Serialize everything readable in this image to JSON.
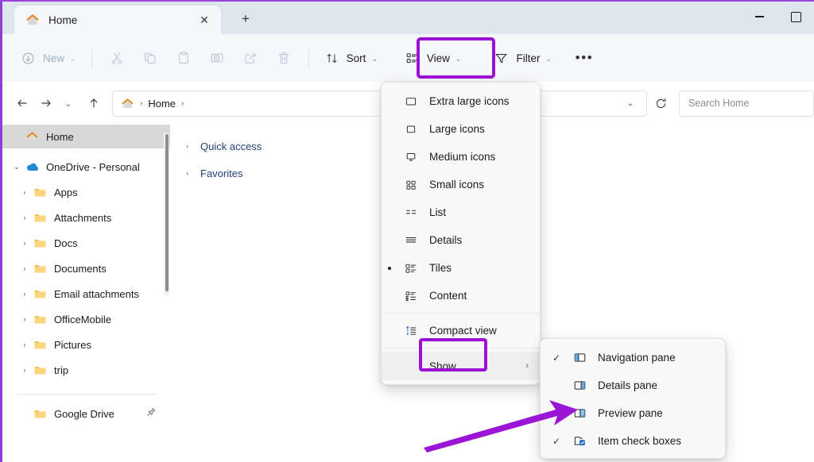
{
  "window": {
    "tab_title": "Home",
    "tab_icon": "home-icon",
    "close_label": "✕",
    "new_tab_label": "+",
    "minimize_label": "minimize-icon",
    "maximize_label": "maximize-icon"
  },
  "toolbar": {
    "new_label": "New",
    "new_chevron": "⌄",
    "cut_label": "cut-icon",
    "copy_label": "copy-icon",
    "paste_label": "paste-icon",
    "rename_label": "rename-icon",
    "share_label": "share-icon",
    "delete_label": "delete-icon",
    "sort_label": "Sort",
    "sort_chevron": "⌄",
    "view_label": "View",
    "view_chevron": "⌄",
    "filter_label": "Filter",
    "filter_chevron": "⌄",
    "overflow_label": "•••"
  },
  "navbar": {
    "back": "←",
    "forward": "→",
    "recent_chevron": "⌄",
    "up": "↑",
    "breadcrumb": {
      "home_icon": "home-icon",
      "sep1": "›",
      "home_text": "Home",
      "sep2": "›"
    },
    "address_chevron": "⌄",
    "refresh": "refresh-icon",
    "search_placeholder": "Search Home"
  },
  "sidebar": {
    "items": [
      {
        "label": "Home",
        "icon": "home-icon",
        "indent": 0,
        "expander": "",
        "selected": true
      },
      {
        "label": "OneDrive - Personal",
        "icon": "onedrive-icon",
        "indent": 0,
        "expander": "⌄",
        "selected": false
      },
      {
        "label": "Apps",
        "icon": "folder-icon",
        "indent": 1,
        "expander": "›",
        "selected": false
      },
      {
        "label": "Attachments",
        "icon": "folder-icon",
        "indent": 1,
        "expander": "›",
        "selected": false
      },
      {
        "label": "Docs",
        "icon": "folder-icon",
        "indent": 1,
        "expander": "›",
        "selected": false
      },
      {
        "label": "Documents",
        "icon": "folder-icon",
        "indent": 1,
        "expander": "›",
        "selected": false
      },
      {
        "label": "Email attachments",
        "icon": "folder-icon",
        "indent": 1,
        "expander": "›",
        "selected": false
      },
      {
        "label": "OfficeMobile",
        "icon": "folder-icon",
        "indent": 1,
        "expander": "›",
        "selected": false
      },
      {
        "label": "Pictures",
        "icon": "folder-icon",
        "indent": 1,
        "expander": "›",
        "selected": false
      },
      {
        "label": "trip",
        "icon": "folder-icon",
        "indent": 1,
        "expander": "›",
        "selected": false
      }
    ],
    "pinned": {
      "label": "Google Drive",
      "icon": "folder-icon",
      "pin": "📌"
    }
  },
  "content": {
    "groups": [
      {
        "label": "Quick access",
        "expander": "›"
      },
      {
        "label": "Favorites",
        "expander": "›"
      }
    ]
  },
  "view_menu": {
    "items": [
      {
        "label": "Extra large icons",
        "icon": "extra-large-icons-icon",
        "checked": false
      },
      {
        "label": "Large icons",
        "icon": "large-icons-icon",
        "checked": false
      },
      {
        "label": "Medium icons",
        "icon": "medium-icons-icon",
        "checked": false
      },
      {
        "label": "Small icons",
        "icon": "small-icons-icon",
        "checked": false
      },
      {
        "label": "List",
        "icon": "list-icon",
        "checked": false
      },
      {
        "label": "Details",
        "icon": "details-icon",
        "checked": false
      },
      {
        "label": "Tiles",
        "icon": "tiles-icon",
        "checked": true
      },
      {
        "label": "Content",
        "icon": "content-icon",
        "checked": false
      },
      {
        "label": "Compact view",
        "icon": "compact-view-icon",
        "checked": false
      }
    ],
    "show_label": "Show",
    "show_chevron": "›"
  },
  "show_submenu": {
    "items": [
      {
        "label": "Navigation pane",
        "icon": "navigation-pane-icon",
        "check": "✓"
      },
      {
        "label": "Details pane",
        "icon": "details-pane-icon",
        "check": ""
      },
      {
        "label": "Preview pane",
        "icon": "preview-pane-icon",
        "check": ""
      },
      {
        "label": "Item check boxes",
        "icon": "item-check-boxes-icon",
        "check": "✓"
      }
    ]
  },
  "annotations": {
    "highlight_color": "#9c0fd4",
    "arrow_color": "#9b15d6",
    "highlighted_items": [
      "View",
      "Show"
    ],
    "arrow_target": "Preview pane"
  }
}
